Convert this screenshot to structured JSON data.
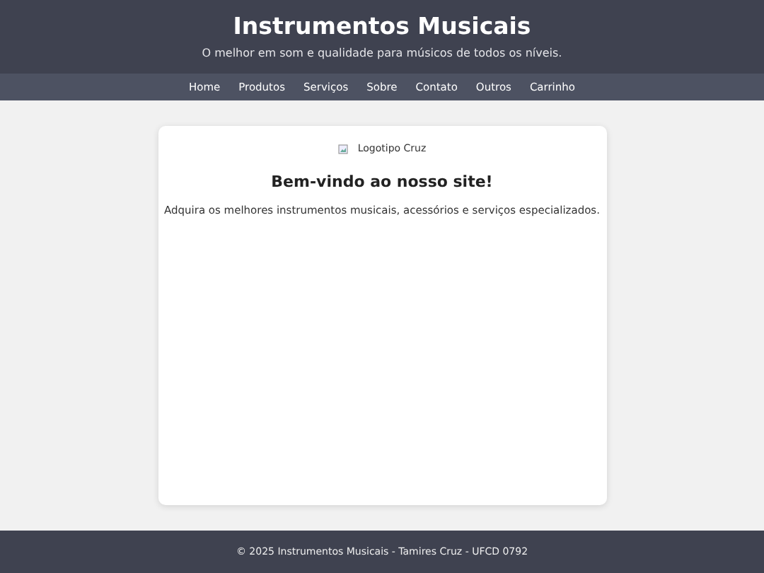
{
  "header": {
    "title": "Instrumentos Musicais",
    "subtitle": "O melhor em som e qualidade para músicos de todos os níveis."
  },
  "nav": [
    "Home",
    "Produtos",
    "Serviços",
    "Sobre",
    "Contato",
    "Outros",
    "Carrinho"
  ],
  "card": {
    "logo_alt": "Logotipo Cruz",
    "heading": "Bem-vindo ao nosso site!",
    "text": "Adquira os melhores instrumentos musicais, acessórios e serviços especializados."
  },
  "footer": "© 2025 Instrumentos Musicais - Tamires Cruz - UFCD 0792"
}
